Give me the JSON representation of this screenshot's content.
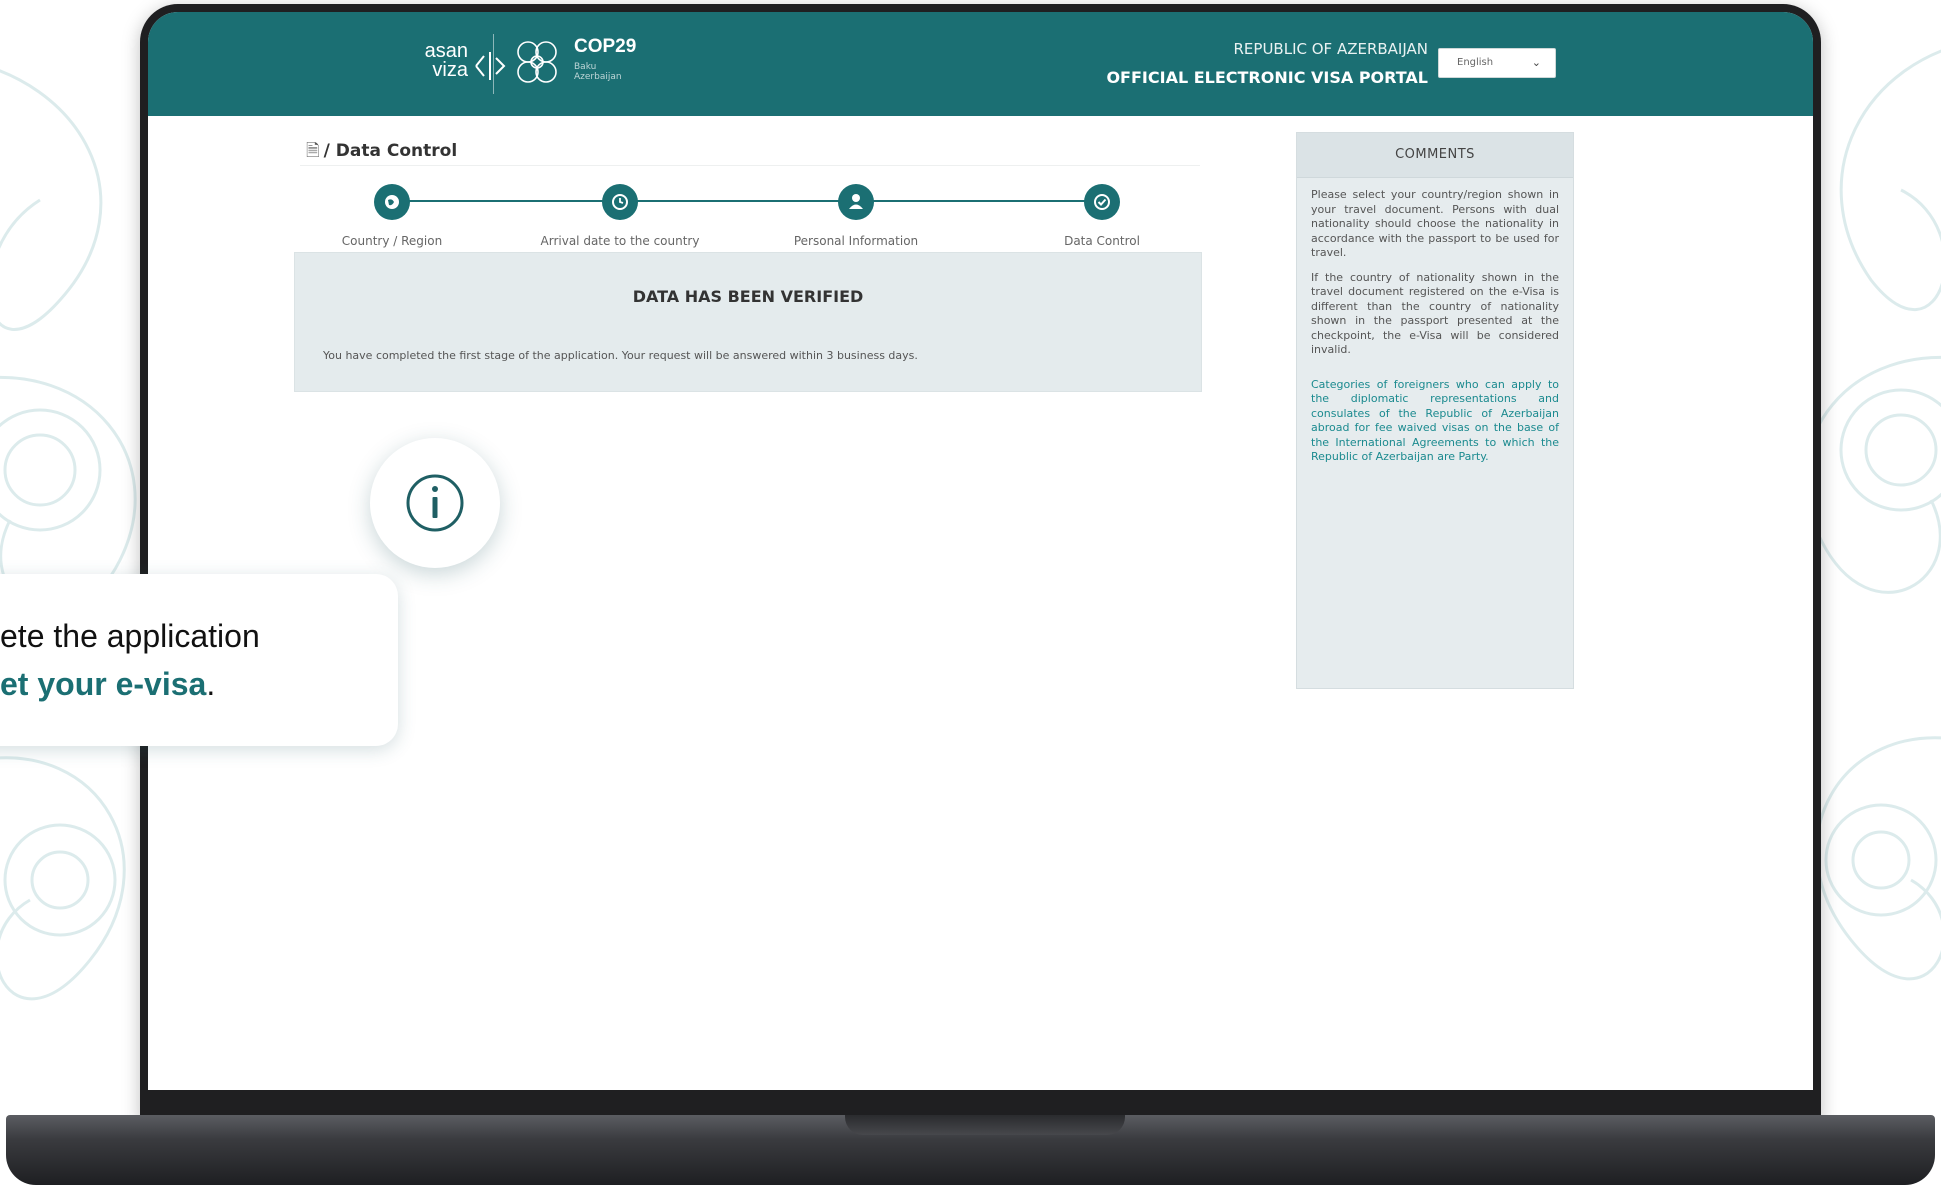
{
  "header": {
    "logo_asan_line1": "asan",
    "logo_asan_line2": "viza",
    "logo_cop": "COP29",
    "logo_cop_sub": "Baku Azerbaijan",
    "portal_subtitle": "REPUBLIC OF AZERBAIJAN",
    "portal_title": "OFFICIAL ELECTRONIC VISA PORTAL",
    "language_selected": "English"
  },
  "breadcrumb": {
    "label": "/ Data Control"
  },
  "steps": [
    {
      "label": "Country / Region",
      "icon": "globe-icon"
    },
    {
      "label": "Arrival date to the country",
      "icon": "clock-icon"
    },
    {
      "label": "Personal Information",
      "icon": "user-icon"
    },
    {
      "label": "Data Control",
      "icon": "check-icon"
    }
  ],
  "verified": {
    "title": "DATA HAS BEEN VERIFIED",
    "message": "You have completed the first stage of the application. Your request will be answered within 3 business days."
  },
  "comments": {
    "title": "COMMENTS",
    "paragraph1": "Please select your country/region shown in your travel document. Persons with dual nationality should choose the nationality in accordance with the passport to be used for travel.",
    "paragraph2": "If the country of nationality shown in the travel document registered on the e-Visa is different than the country of nationality shown in the passport presented at the checkpoint, the e-Visa will be considered invalid.",
    "link": "Categories of foreigners who can apply to the diplomatic representations and consulates of the Republic of Azerbaijan abroad for fee waived visas on the base of the International Agreements to which the Republic of Azerbaijan are Party."
  },
  "callout": {
    "line1": "ete the application",
    "line2_bold": "et your e-visa",
    "line2_tail": "."
  },
  "colors": {
    "brand": "#1b6f73",
    "panel": "#e4ebed",
    "link": "#1b8a8f"
  }
}
